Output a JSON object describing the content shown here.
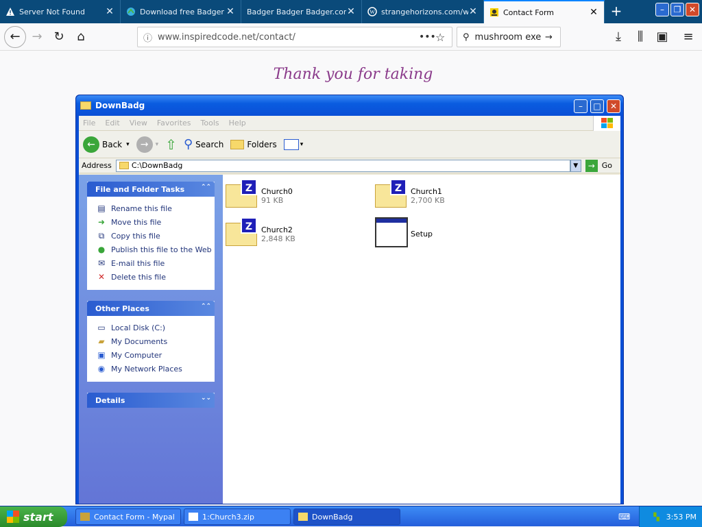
{
  "browser": {
    "tabs": [
      {
        "title": "Server Not Found",
        "active": false
      },
      {
        "title": "Download free Badger",
        "active": false
      },
      {
        "title": "Badger Badger Badger.com",
        "active": false
      },
      {
        "title": "strangehorizons.com/w",
        "active": false
      },
      {
        "title": "Contact Form",
        "active": true
      }
    ],
    "url": "www.inspiredcode.net/contact/",
    "search_value": "mushroom exe"
  },
  "page": {
    "heading": "Thank you for taking"
  },
  "explorer": {
    "title": "DownBadg",
    "menu": [
      "File",
      "Edit",
      "View",
      "Favorites",
      "Tools",
      "Help"
    ],
    "toolbar": {
      "back": "Back",
      "search": "Search",
      "folders": "Folders"
    },
    "address_label": "Address",
    "address_value": "C:\\DownBadg",
    "go_label": "Go",
    "tasks_group": {
      "title": "File and Folder Tasks",
      "items": [
        "Rename this file",
        "Move this file",
        "Copy this file",
        "Publish this file to the Web",
        "E-mail this file",
        "Delete this file"
      ]
    },
    "places_group": {
      "title": "Other Places",
      "items": [
        "Local Disk (C:)",
        "My Documents",
        "My Computer",
        "My Network Places"
      ]
    },
    "details_group": {
      "title": "Details"
    },
    "files": [
      {
        "name": "Church0",
        "size": "91 KB",
        "type": "zip"
      },
      {
        "name": "Church1",
        "size": "2,700 KB",
        "type": "zip"
      },
      {
        "name": "Church2",
        "size": "2,848 KB",
        "type": "zip"
      },
      {
        "name": "Setup",
        "size": "",
        "type": "exe"
      }
    ]
  },
  "taskbar": {
    "start_label": "start",
    "buttons": [
      {
        "label": "Contact Form - Mypal"
      },
      {
        "label": "1:Church3.zip"
      },
      {
        "label": "DownBadg"
      }
    ],
    "clock": "3:53 PM"
  }
}
